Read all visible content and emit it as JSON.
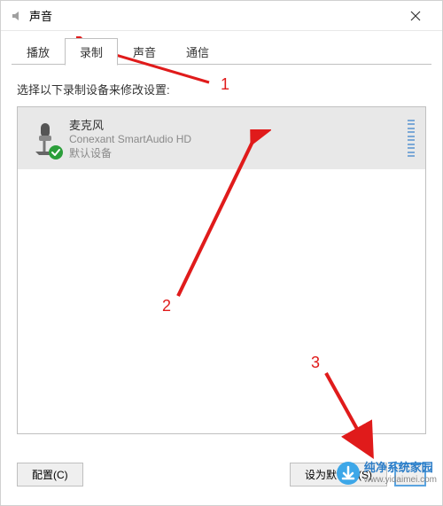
{
  "window": {
    "title": "声音",
    "close_label": "×"
  },
  "tabs": {
    "playback": "播放",
    "recording": "录制",
    "sounds": "声音",
    "communications": "通信",
    "active": "recording"
  },
  "instruction": "选择以下录制设备来修改设置:",
  "device": {
    "name": "麦克风",
    "driver": "Conexant SmartAudio HD",
    "status": "默认设备"
  },
  "buttons": {
    "configure": "配置(C)",
    "set_default": "设为默认值(S)"
  },
  "annotations": {
    "label1": "1",
    "label2": "2",
    "label3": "3"
  },
  "watermark": {
    "title": "纯净系统家园",
    "url": "www.yidaimei.com"
  }
}
